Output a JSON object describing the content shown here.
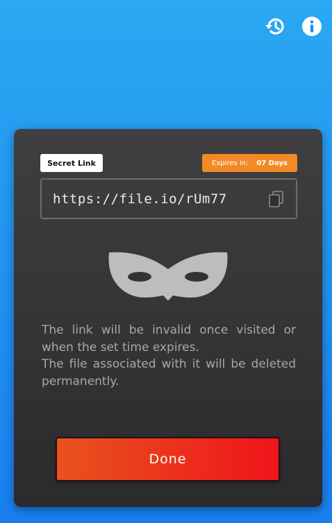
{
  "header": {
    "history_icon": "history-icon",
    "info_icon": "info-icon"
  },
  "card": {
    "secret_label": "Secret Link",
    "expires_label": "Expires in:",
    "expires_value": "07 Days",
    "link": "https://file.io/rUm77",
    "copy_icon": "copy-icon",
    "mask_icon": "mask-icon",
    "description_line1": "The link will be invalid once visited or when the set time expires.",
    "description_line2": "The file associated with it will be deleted permanently.",
    "done_label": "Done"
  },
  "colors": {
    "background_top": "#2aa8f2",
    "background_bottom": "#1a7ef0",
    "card": "#333335",
    "expires_badge": "#f28a25",
    "done_start": "#e8531f",
    "done_end": "#f0141a"
  }
}
